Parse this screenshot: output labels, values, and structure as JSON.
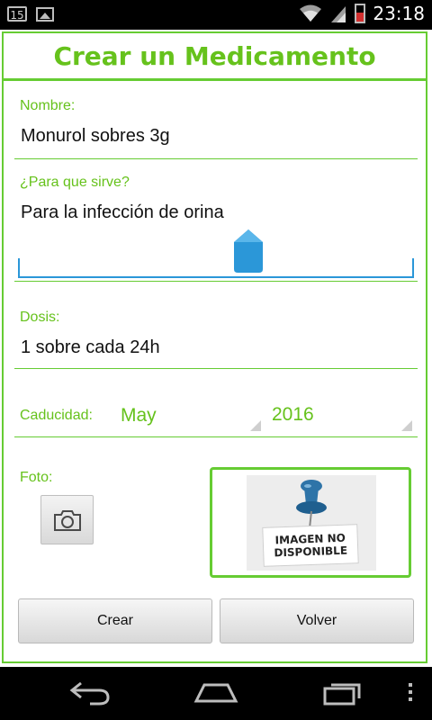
{
  "status_bar": {
    "notification_badge": "15",
    "time": "23:18",
    "icons": [
      "calendar-badge-icon",
      "gallery-icon",
      "wifi-icon",
      "signal-icon",
      "battery-low-icon"
    ]
  },
  "app": {
    "title": "Crear un Medicamento",
    "accent_color": "#66c21c"
  },
  "form": {
    "nombre": {
      "label": "Nombre:",
      "value": "Monurol  sobres 3g"
    },
    "para_que_sirve": {
      "label": "¿Para que sirve?",
      "value": "Para la infección de orina"
    },
    "dosis": {
      "label": "Dosis:",
      "value": "1 sobre cada 24h"
    },
    "caducidad": {
      "label": "Caducidad:",
      "month": "May",
      "year": "2016"
    },
    "foto": {
      "label": "Foto:",
      "camera_icon": "camera-icon",
      "placeholder_line1": "IMAGEN NO",
      "placeholder_line2": "DISPONIBLE",
      "placeholder_icon": "pushpin-icon"
    }
  },
  "actions": {
    "crear": "Crear",
    "volver": "Volver"
  },
  "nav_bar": {
    "icons": [
      "back-icon",
      "home-icon",
      "recent-apps-icon",
      "menu-icon"
    ]
  }
}
